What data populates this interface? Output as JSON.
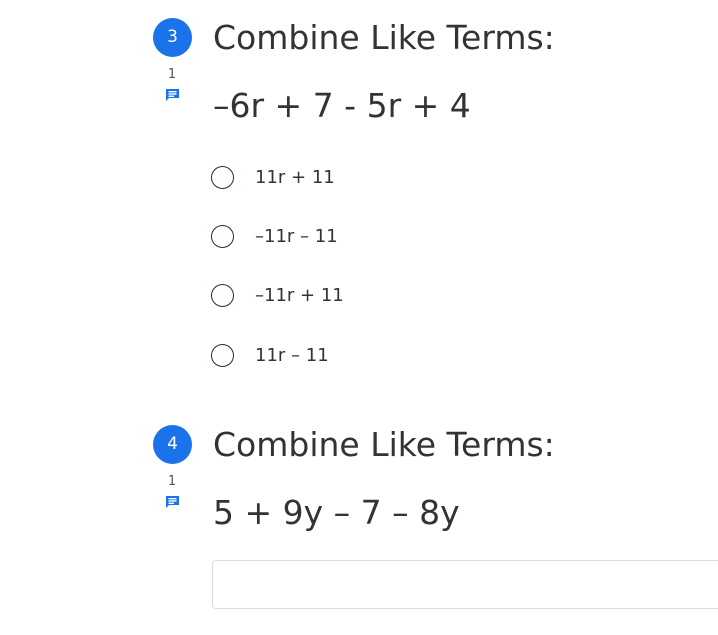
{
  "questions": [
    {
      "number": "3",
      "comment_count": "1",
      "title": "Combine Like Terms:",
      "expression": "–6r + 7 - 5r + 4",
      "options": [
        "11r + 11",
        "–11r – 11",
        "–11r + 11",
        "11r – 11"
      ]
    },
    {
      "number": "4",
      "comment_count": "1",
      "title": "Combine Like Terms:",
      "expression": "5 + 9y – 7 – 8y",
      "answer_value": ""
    }
  ],
  "icons": {
    "comment": "comment-icon",
    "radio": "radio-button"
  },
  "colors": {
    "badge": "#1a73e8",
    "radio_border": "#1f2a44",
    "text": "#333333"
  }
}
